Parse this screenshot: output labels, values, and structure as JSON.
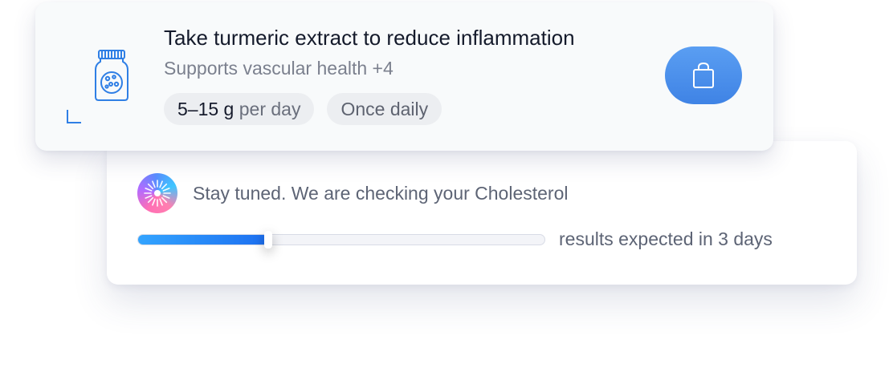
{
  "supplement": {
    "title": "Take turmeric extract to reduce inflammation",
    "subtitle": "Supports vascular health +4",
    "dose_value": "5–15 g",
    "dose_unit": "per day",
    "frequency": "Once daily",
    "icon": "supplement-jar-icon",
    "action_icon": "shopping-bag-icon"
  },
  "status": {
    "message": "Stay tuned. We are checking your Cholesterol",
    "eta": "results expected in 3 days",
    "progress": 0.32,
    "icon": "sunburst-icon"
  },
  "colors": {
    "accent": "#4a90e8",
    "progress_start": "#33a4ff",
    "progress_end": "#1d6ff0"
  }
}
